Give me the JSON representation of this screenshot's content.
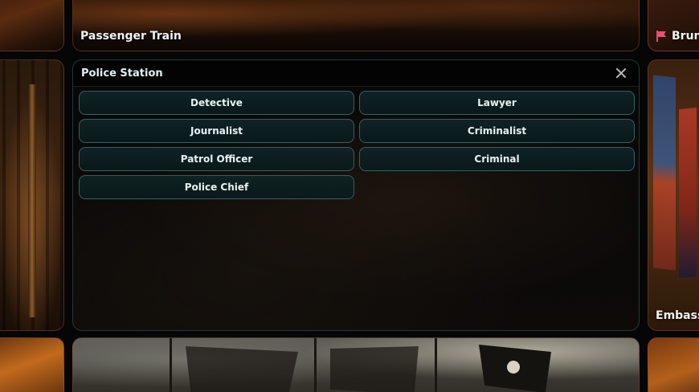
{
  "cards": {
    "top_center_label": "Passenger Train",
    "top_right_label": "Brun",
    "right_label": "Embassy"
  },
  "popup": {
    "title": "Police Station",
    "roles": [
      "Detective",
      "Lawyer",
      "Journalist",
      "Criminalist",
      "Patrol Officer",
      "Criminal",
      "Police Chief"
    ]
  },
  "icons": {
    "close": "close-icon",
    "flag": "flag-icon"
  },
  "colors": {
    "popup_border": "#466e6e",
    "role_button_bg": "#10242a",
    "role_button_border": "#5a9696",
    "flag_pink": "#ef4f72"
  }
}
